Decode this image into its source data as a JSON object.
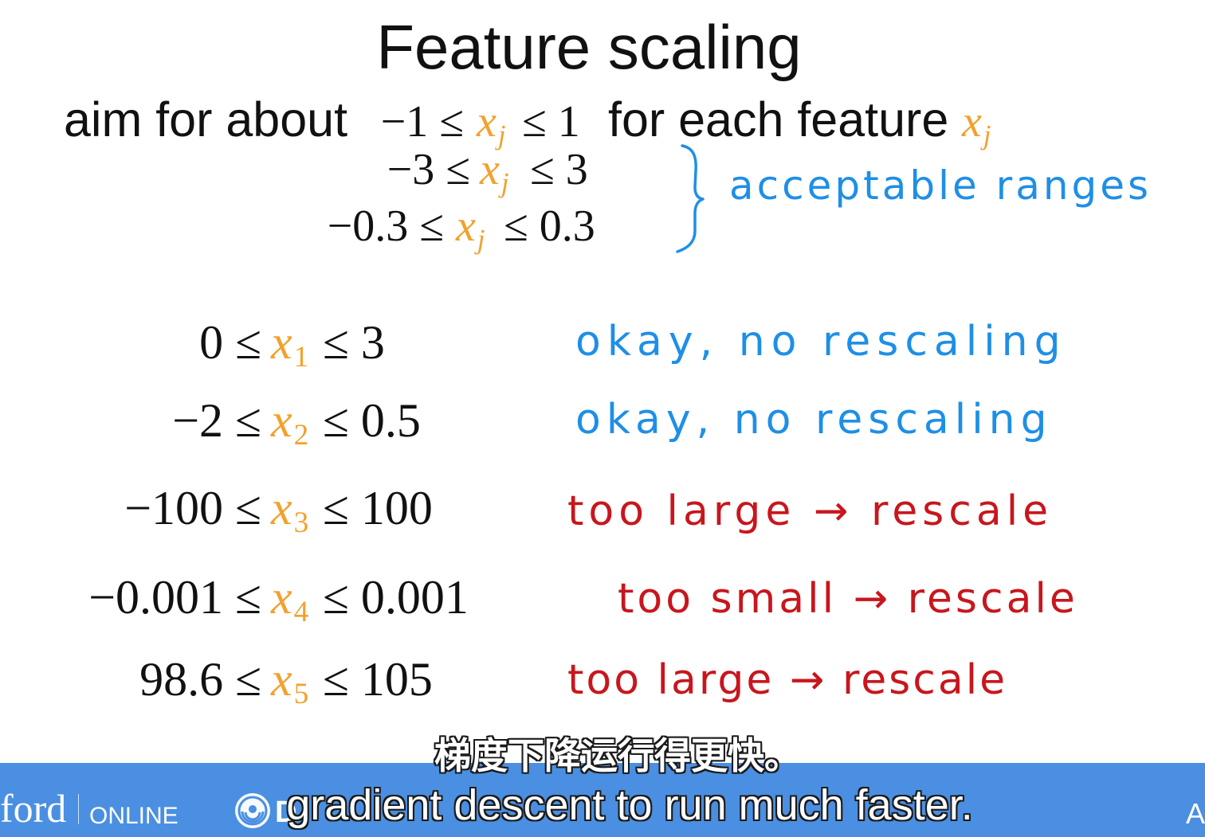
{
  "colors": {
    "text": "#111111",
    "variable": "#f2a12d",
    "note_ok": "#1e8fe6",
    "note_rescale": "#c8161d",
    "band": "#4a8fe1"
  },
  "slide": {
    "title": "Feature scaling",
    "aim": {
      "text_before": "aim for about",
      "lower": "−1 ≤",
      "variable": "x",
      "subscript": "j",
      "upper": "≤ 1",
      "text_after": "for each feature",
      "feature_variable": "x",
      "feature_subscript": "j"
    },
    "acceptable": {
      "ranges": [
        {
          "lower": "−3 ≤",
          "variable": "x",
          "subscript": "j",
          "upper": "≤ 3"
        },
        {
          "lower": "−0.3 ≤",
          "variable": "x",
          "subscript": "j",
          "upper": "≤ 0.3"
        }
      ],
      "note": "acceptable ranges",
      "brace_icon": "curly-brace"
    },
    "examples": [
      {
        "lower": "0 ≤",
        "variable": "x",
        "subscript": "1",
        "upper": "≤ 3",
        "note": "okay, no rescaling",
        "note_color": "#1e8fe6"
      },
      {
        "lower": "−2 ≤",
        "variable": "x",
        "subscript": "2",
        "upper": "≤ 0.5",
        "note": "okay, no rescaling",
        "note_color": "#1e8fe6"
      },
      {
        "lower": "−100 ≤",
        "variable": "x",
        "subscript": "3",
        "upper": "≤ 100",
        "note": "too large → rescale",
        "note_color": "#c8161d"
      },
      {
        "lower": "−0.001 ≤",
        "variable": "x",
        "subscript": "4",
        "upper": "≤ 0.001",
        "note": "too small → rescale",
        "note_color": "#c8161d"
      },
      {
        "lower": "98.6 ≤",
        "variable": "x",
        "subscript": "5",
        "upper": "≤ 105",
        "note": "too large → rescale",
        "note_color": "#c8161d"
      }
    ]
  },
  "footer": {
    "brand_left": "ford",
    "brand_left_suffix": "ONLINE",
    "logo_icon": "deeplearning-logo-icon",
    "logo_letter": "D",
    "right_letter": "A"
  },
  "subtitles": {
    "chinese": "梯度下降运行得更快。",
    "english": "gradient descent to run much faster."
  }
}
